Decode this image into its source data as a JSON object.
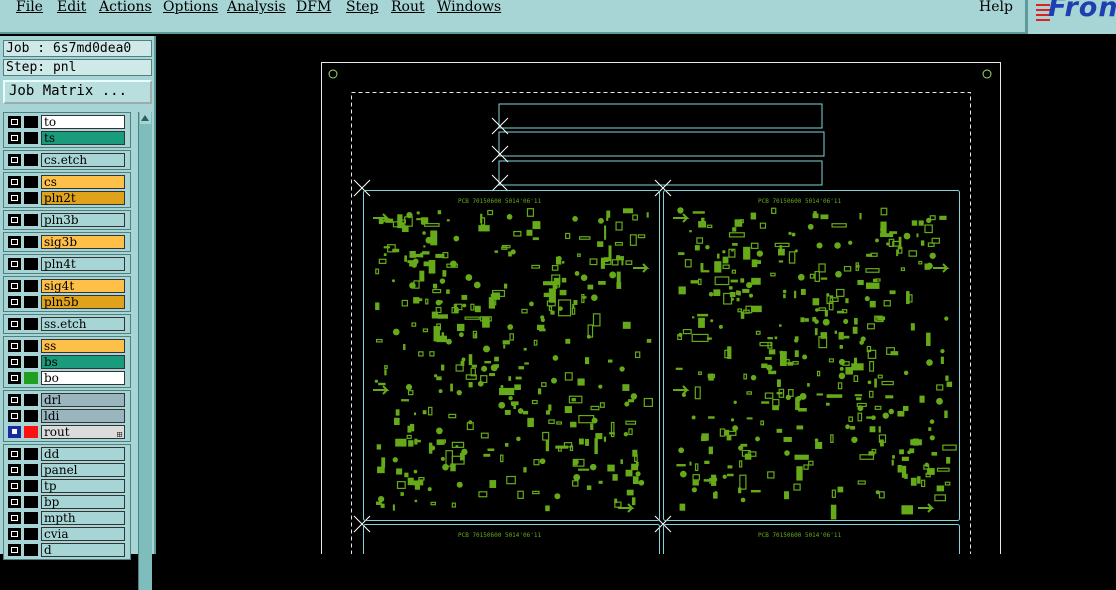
{
  "menu": {
    "file": "File",
    "edit": "Edit",
    "actions": "Actions",
    "options": "Options",
    "analysis": "Analysis",
    "dfm": "DFM",
    "step": "Step",
    "rout": "Rout",
    "windows": "Windows",
    "help": "Help"
  },
  "logo": {
    "text": "Fron"
  },
  "job": {
    "label": "Job : 6s7md0dea0",
    "step_label": "Step: pnl",
    "matrix_button": "Job Matrix ..."
  },
  "layers": [
    [
      {
        "name": "to",
        "color": "#ffffff"
      },
      {
        "name": "ts",
        "color": "#1a9c7c"
      }
    ],
    [
      {
        "name": "cs.etch",
        "color": "#a7d5d5"
      }
    ],
    [
      {
        "name": "cs",
        "color": "#ffc04a"
      },
      {
        "name": "pln2t",
        "color": "#e0a11b"
      }
    ],
    [
      {
        "name": "pln3b",
        "color": "#a7d5d5"
      }
    ],
    [
      {
        "name": "sig3b",
        "color": "#ffc04a"
      }
    ],
    [
      {
        "name": "pln4t",
        "color": "#a7d5d5"
      }
    ],
    [
      {
        "name": "sig4t",
        "color": "#ffc04a"
      },
      {
        "name": "pln5b",
        "color": "#e0a11b"
      }
    ],
    [
      {
        "name": "ss.etch",
        "color": "#a7d5d5"
      }
    ],
    [
      {
        "name": "ss",
        "color": "#ffc04a"
      },
      {
        "name": "bs",
        "color": "#1a9c7c"
      },
      {
        "name": "bo",
        "color": "#ffffff",
        "swatch": "#20a020"
      }
    ],
    [
      {
        "name": "drl",
        "color": "#9ab5be"
      },
      {
        "name": "ldi",
        "color": "#9ab5be"
      },
      {
        "name": "rout",
        "color": "#dcdcdc",
        "swatch": "#ff1010",
        "selected": true,
        "flag": "⊞"
      }
    ],
    [
      {
        "name": "dd",
        "color": "#a7d5d5"
      },
      {
        "name": "panel",
        "color": "#a7d5d5"
      },
      {
        "name": "tp",
        "color": "#a7d5d5"
      },
      {
        "name": "bp",
        "color": "#a7d5d5"
      },
      {
        "name": "mpth",
        "color": "#a7d5d5"
      },
      {
        "name": "cvia",
        "color": "#a7d5d5"
      },
      {
        "name": "d",
        "color": "#a7d5d5"
      }
    ]
  ],
  "board": {
    "text": "PCB 70150600 5014'06'11"
  },
  "colors": {
    "panel_bg": "#a7d5d5",
    "outline": "#7fd4dc",
    "copper": "#66aa1a"
  }
}
